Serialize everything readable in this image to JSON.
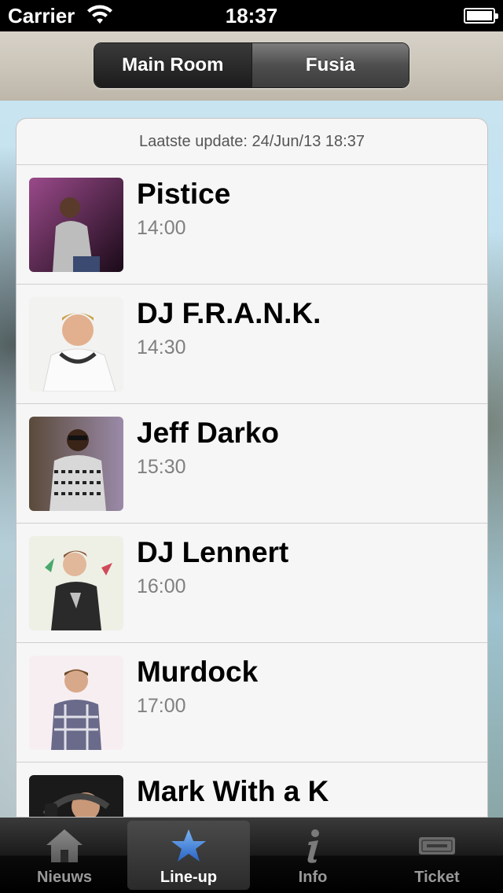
{
  "status_bar": {
    "carrier": "Carrier",
    "time": "18:37"
  },
  "segmented_control": {
    "options": [
      "Main Room",
      "Fusia"
    ],
    "selected": "Main Room"
  },
  "list": {
    "update_text": "Laatste update: 24/Jun/13 18:37",
    "items": [
      {
        "name": "Pistice",
        "time": "14:00"
      },
      {
        "name": "DJ F.R.A.N.K.",
        "time": "14:30"
      },
      {
        "name": "Jeff Darko",
        "time": "15:30"
      },
      {
        "name": "DJ Lennert",
        "time": "16:00"
      },
      {
        "name": "Murdock",
        "time": "17:00"
      },
      {
        "name": "Mark With a K",
        "time": ""
      }
    ]
  },
  "tab_bar": {
    "tabs": [
      {
        "label": "Nieuws",
        "icon": "house-icon"
      },
      {
        "label": "Line-up",
        "icon": "star-icon"
      },
      {
        "label": "Info",
        "icon": "info-icon"
      },
      {
        "label": "Ticket",
        "icon": "ticket-icon"
      }
    ],
    "active": "Line-up",
    "active_color": "#3f7fd6"
  }
}
